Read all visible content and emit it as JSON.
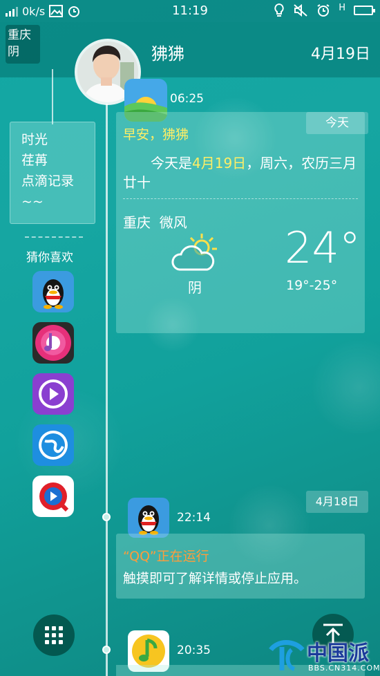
{
  "status_bar": {
    "speed": "0k/s",
    "time": "11:19",
    "network": "H"
  },
  "header": {
    "location_line1": "重庆",
    "location_line2": "阴",
    "user_name": "狒狒",
    "date": "4月19日"
  },
  "sidebar": {
    "note": [
      "时光",
      "荏苒",
      "点滴记录",
      "~~"
    ],
    "guess_label": "猜你喜欢",
    "apps": [
      {
        "name": "QQ",
        "icon": "qq-penguin-icon"
      },
      {
        "name": "music",
        "icon": "music-note-icon"
      },
      {
        "name": "video player",
        "icon": "play-icon"
      },
      {
        "name": "browser",
        "icon": "globe-icon"
      },
      {
        "name": "QQ video",
        "icon": "qq-video-icon"
      }
    ]
  },
  "timeline": {
    "entry1": {
      "time": "06:25",
      "today_label": "今天",
      "greeting": "早安，狒狒",
      "date_prefix": "今天是",
      "date_hl": "4月19日",
      "date_suffix": "，周六，农历三月廿十",
      "city": "重庆",
      "wind": "微风",
      "weather": "阴",
      "temp": "24°",
      "range": "19°-25°"
    },
    "entry2": {
      "date_label": "4月18日",
      "time": "22:14",
      "title_quote": "“QQ”",
      "title_rest": "正在运行",
      "desc": "触摸即可了解详情或停止应用。"
    },
    "entry3": {
      "time": "20:35"
    }
  },
  "watermark": {
    "brand": "中国派",
    "url": "BBS.CN314.COM"
  },
  "colors": {
    "accent_yellow": "#ffee66",
    "accent_orange": "#ff9c3a",
    "bg_teal": "#12a8a4"
  }
}
